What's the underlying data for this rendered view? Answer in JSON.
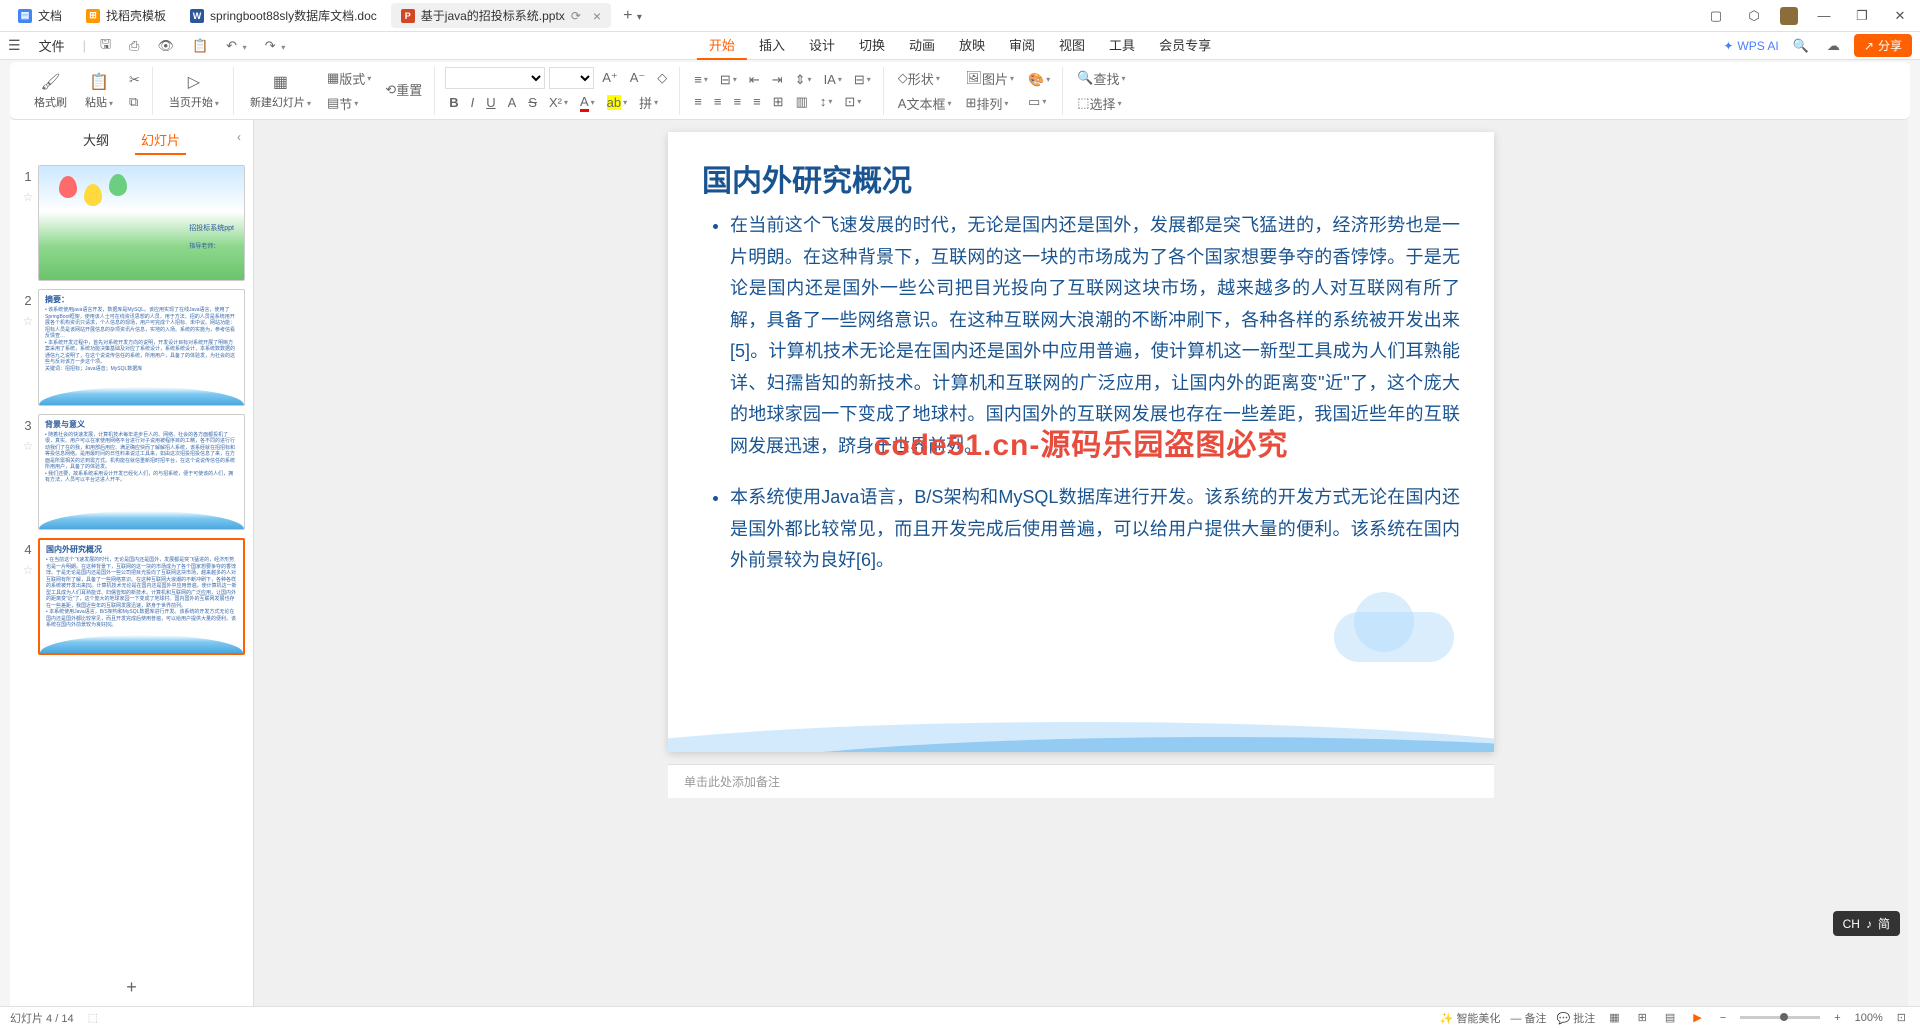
{
  "titlebar": {
    "tabs": [
      {
        "label": "文档",
        "icon": "doc"
      },
      {
        "label": "找稻壳模板",
        "icon": "search"
      },
      {
        "label": "springboot88sly数据库文档.doc",
        "icon": "word"
      },
      {
        "label": "基于java的招投标系统.pptx",
        "icon": "ppt",
        "active": true
      }
    ],
    "add": "+"
  },
  "menubar": {
    "file": "文件",
    "tabs": [
      "开始",
      "插入",
      "设计",
      "切换",
      "动画",
      "放映",
      "审阅",
      "视图",
      "工具",
      "会员专享"
    ],
    "active_tab": "开始",
    "wps_ai": "WPS AI",
    "share": "分享"
  },
  "ribbon": {
    "format_painter": "格式刷",
    "paste": "粘贴",
    "start_current": "当页开始",
    "new_slide": "新建幻灯片",
    "layout": "版式",
    "section": "节",
    "reset": "重置",
    "shape": "形状",
    "textbox": "文本框",
    "image": "图片",
    "arrange": "排列",
    "find": "查找",
    "select": "选择"
  },
  "slidepanel": {
    "tab_outline": "大纲",
    "tab_slides": "幻灯片",
    "slides": [
      {
        "num": "1",
        "title": "招投标系统ppt",
        "subtitle": "指导老师："
      },
      {
        "num": "2",
        "title": "摘要："
      },
      {
        "num": "3",
        "title": "背景与意义"
      },
      {
        "num": "4",
        "title": "国内外研究概况",
        "active": true
      }
    ],
    "add": "+"
  },
  "slide": {
    "title": "国内外研究概况",
    "bullets": [
      "在当前这个飞速发展的时代，无论是国内还是国外，发展都是突飞猛进的，经济形势也是一片明朗。在这种背景下，互联网的这一块的市场成为了各个国家想要争夺的香饽饽。于是无论是国内还是国外一些公司把目光投向了互联网这块市场，越来越多的人对互联网有所了解，具备了一些网络意识。在这种互联网大浪潮的不断冲刷下，各种各样的系统被开发出来[5]。计算机技术无论是在国内还是国外中应用普遍，使计算机这一新型工具成为人们耳熟能详、妇孺皆知的新技术。计算机和互联网的广泛应用，让国内外的距离变\"近\"了，这个庞大的地球家园一下变成了地球村。国内国外的互联网发展也存在一些差距，我国近些年的互联网发展迅速，跻身于世界前列。",
      "本系统使用Java语言，B/S架构和MySQL数据库进行开发。该系统的开发方式无论在国内还是国外都比较常见，而且开发完成后使用普遍，可以给用户提供大量的便利。该系统在国内外前景较为良好[6]。"
    ],
    "watermark": "code51.cn-源码乐园盗图必究"
  },
  "notes": {
    "placeholder": "单击此处添加备注"
  },
  "ime": {
    "lang": "CH",
    "mode": "简"
  },
  "statusbar": {
    "slide_info": "幻灯片 4 / 14",
    "smart_beauty": "智能美化",
    "remarks": "备注",
    "comments": "批注",
    "zoom": "100%"
  }
}
